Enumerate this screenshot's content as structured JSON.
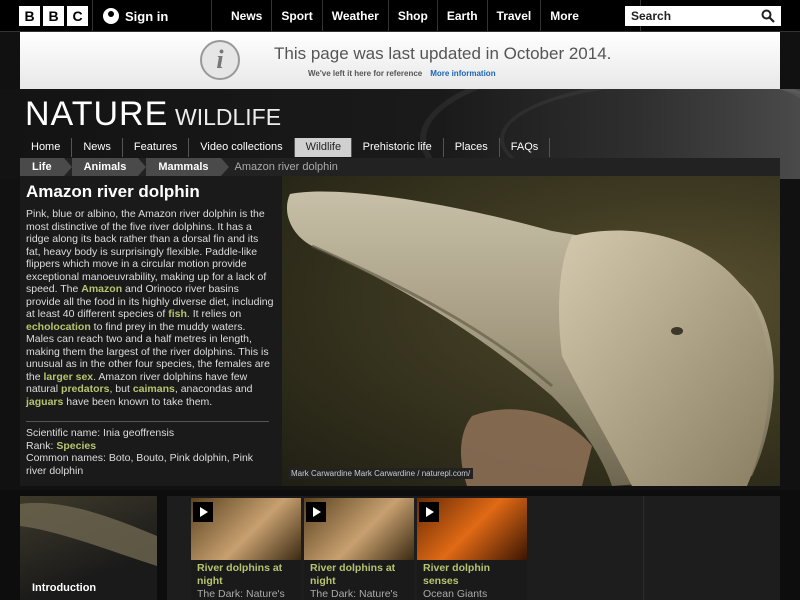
{
  "header": {
    "logo_letters": [
      "B",
      "B",
      "C"
    ],
    "signin_label": "Sign in",
    "nav": [
      "News",
      "Sport",
      "Weather",
      "Shop",
      "Earth",
      "Travel",
      "More"
    ],
    "search_placeholder": "Search"
  },
  "notice": {
    "title": "This page was last updated in October 2014.",
    "subtitle": "We've left it here for reference",
    "more_link": "More information"
  },
  "brand": {
    "title": "NATURE",
    "section": "WILDLIFE"
  },
  "section_nav": [
    "Home",
    "News",
    "Features",
    "Video collections",
    "Wildlife",
    "Prehistoric life",
    "Places",
    "FAQs"
  ],
  "section_nav_active": "Wildlife",
  "breadcrumb": [
    "Life",
    "Animals",
    "Mammals"
  ],
  "breadcrumb_current": "Amazon river dolphin",
  "article": {
    "title": "Amazon river dolphin",
    "p1": "Pink, blue or albino, the Amazon river dolphin is the most distinctive of the five river dolphins. It has a ridge along its back rather than a dorsal fin and its fat, heavy body is surprisingly flexible. Paddle-like flippers which move in a circular motion provide exceptional manoeuvrability, making up for a lack of speed. The ",
    "link_amazon": "Amazon",
    "p2": " and Orinoco river basins provide all the food in its highly diverse diet, including at least 40 different species of ",
    "link_fish": "fish",
    "p3": ". It relies on ",
    "link_echolocation": "echolocation",
    "p4": " to find prey in the muddy waters. Males can reach two and a half metres in length, making them the largest of the river dolphins. This is unusual as in the other four species, the females are the ",
    "link_larger_sex": "larger sex",
    "p5": ". Amazon river dolphins have few natural ",
    "link_predators": "predators",
    "p6": ", but ",
    "link_caimans": "caimans",
    "p7": ", anacondas and ",
    "link_jaguars": "jaguars",
    "p8": " have been known to take them."
  },
  "facts": {
    "scientific_label": "Scientific name:",
    "scientific_value": "Inia geoffrensis",
    "rank_label": "Rank:",
    "rank_value": "Species",
    "common_label": "Common names:",
    "common_value": "Boto, Bouto, Pink dolphin, Pink river dolphin"
  },
  "photo": {
    "credit": "Mark Carwardine Mark Carwardine / naturepl.com/"
  },
  "intro": {
    "label": "Introduction"
  },
  "videos": [
    {
      "title": "River dolphins at night",
      "subtitle": "The Dark: Nature's"
    },
    {
      "title": "River dolphins at night",
      "subtitle": "The Dark: Nature's"
    },
    {
      "title": "River dolphin senses",
      "subtitle": "Ocean Giants"
    }
  ]
}
